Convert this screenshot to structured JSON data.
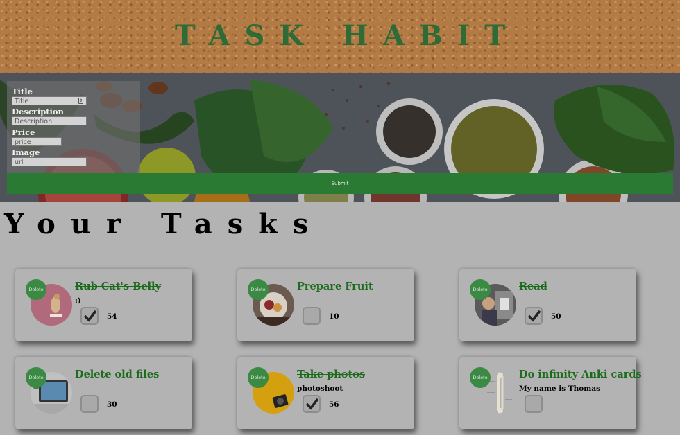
{
  "header": {
    "title": "TASK HABIT"
  },
  "form": {
    "title_label": "Title",
    "title_placeholder": "Title",
    "description_label": "Description",
    "description_placeholder": "Description",
    "price_label": "Price",
    "price_placeholder": "price",
    "image_label": "Image",
    "image_placeholder": "url",
    "submit_label": "Submit"
  },
  "tasks_section": {
    "title": "Your Tasks"
  },
  "tasks": [
    {
      "title": "Rub Cat's Belly",
      "description": ":)",
      "price": "54",
      "done": true,
      "thumb": "cat-toy",
      "delete_label": "Delete"
    },
    {
      "title": "Prepare Fruit",
      "description": "",
      "price": "10",
      "done": false,
      "thumb": "fruit-plate",
      "delete_label": "Delete"
    },
    {
      "title": "Read",
      "description": "",
      "price": "50",
      "done": true,
      "thumb": "person-reading",
      "delete_label": "Delete"
    },
    {
      "title": "Delete old files",
      "description": "",
      "price": "30",
      "done": false,
      "thumb": "tablet-desk",
      "delete_label": "Delete"
    },
    {
      "title": "Take photos",
      "description": "photoshoot",
      "price": "56",
      "done": true,
      "thumb": "camera-yellow",
      "delete_label": "Delete"
    },
    {
      "title": "Do infinity Anki cards",
      "description": "My name is Thomas",
      "price": "",
      "done": false,
      "thumb": "skeleton-arm",
      "delete_label": "Delete"
    }
  ],
  "colors": {
    "accent_green": "#2a7a33",
    "title_green": "#2e6b36",
    "task_title_green": "#1c6a1c"
  }
}
